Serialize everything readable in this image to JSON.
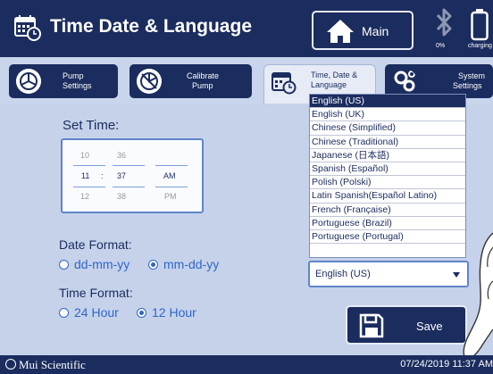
{
  "header": {
    "title": "Time Date & Language",
    "main_label": "Main",
    "bluetooth_pct": "0%",
    "battery_label": "charging"
  },
  "tabs": [
    {
      "label_line1": "Pump",
      "label_line2": "Settings"
    },
    {
      "label_line1": "Calibrate",
      "label_line2": "Pump"
    },
    {
      "label_line1": "Time, Date &",
      "label_line2": "Language"
    },
    {
      "label_line1": "System",
      "label_line2": "Settings"
    }
  ],
  "set_time": {
    "label": "Set Time:",
    "hour_prev": "10",
    "hour": "11",
    "hour_next": "12",
    "separator": ":",
    "minute_prev": "36",
    "minute": "37",
    "minute_next": "38",
    "ampm": "AM",
    "ampm_next": "PM"
  },
  "date_format": {
    "label": "Date Format:",
    "options": [
      "dd-mm-yy",
      "mm-dd-yy"
    ],
    "selected": "mm-dd-yy"
  },
  "time_format": {
    "label": "Time Format:",
    "options": [
      "24 Hour",
      "12 Hour"
    ],
    "selected": "12 Hour"
  },
  "language": {
    "selected": "English (US)",
    "options": [
      "English (US)",
      "English (UK)",
      "Chinese (Simplified)",
      "Chinese (Traditional)",
      "Japanese (日本語)",
      "Spanish (Español)",
      "Polish (Polski)",
      "Latin Spanish(Español Latino)",
      "French (Française)",
      "Portuguese (Brazil)",
      "Portuguese (Portugal)"
    ]
  },
  "save_label": "Save",
  "footer": {
    "brand": "Mui Scientific",
    "datetime": "07/24/2019 11:37 AM"
  },
  "colors": {
    "navy": "#1b2c5e",
    "panel": "#c6d2ea",
    "accent_blue": "#2f66c8",
    "field_border": "#5f86c9"
  }
}
